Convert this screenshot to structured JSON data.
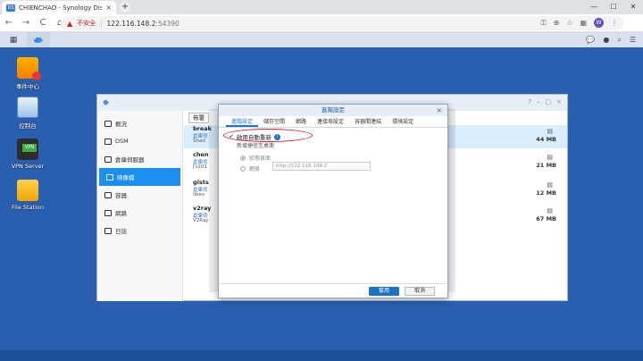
{
  "browser": {
    "tab_title": "CHIENCHAO - Synology DiskS",
    "tab_close": "×",
    "new_tab": "+",
    "min": "—",
    "max": "☐",
    "close": "✕",
    "back": "←",
    "forward": "→",
    "reload": "C",
    "home": "⌂",
    "insecure_label": "不安全",
    "url_host": "122.116.148.2",
    "url_port": ":54390",
    "avatar_letter": "W"
  },
  "desktop": {
    "icons": [
      {
        "label": "事件中心"
      },
      {
        "label": "控制台"
      },
      {
        "label": "VPN Server"
      },
      {
        "label": "File Station"
      }
    ]
  },
  "app": {
    "sidebar": [
      {
        "label": "概況"
      },
      {
        "label": "DSM"
      },
      {
        "label": "倉庫伺服器"
      },
      {
        "label": "映像檔"
      },
      {
        "label": "容器"
      },
      {
        "label": "網路"
      },
      {
        "label": "日誌"
      }
    ],
    "toolbar_label": "佈署",
    "rows": [
      {
        "name": "break",
        "sub1": "倉庫伺",
        "sub2": "Shad",
        "size": "44 MB"
      },
      {
        "name": "chen",
        "sub1": "倉庫伺",
        "sub2": "[v201",
        "size": "21 MB"
      },
      {
        "name": "gists",
        "sub1": "倉庫伺",
        "sub2": "libev",
        "size": "12 MB"
      },
      {
        "name": "v2ray",
        "sub1": "倉庫伺",
        "sub2": "V2Ray",
        "size": "67 MB"
      }
    ]
  },
  "dialog": {
    "title": "進階設定",
    "close": "×",
    "tabs": [
      {
        "label": "進階設定"
      },
      {
        "label": "儲存空間"
      },
      {
        "label": "網路"
      },
      {
        "label": "連接埠設定"
      },
      {
        "label": "容器間連結"
      },
      {
        "label": "環境設定"
      }
    ],
    "auto_restart_label": "啟用自動重新",
    "shortcut_label": "新增捷徑至桌面",
    "status_page_label": "狀態頁面",
    "webpage_label": "網頁",
    "url_value": "http://122.116.148.2",
    "apply_label": "套用",
    "cancel_label": "取消"
  }
}
